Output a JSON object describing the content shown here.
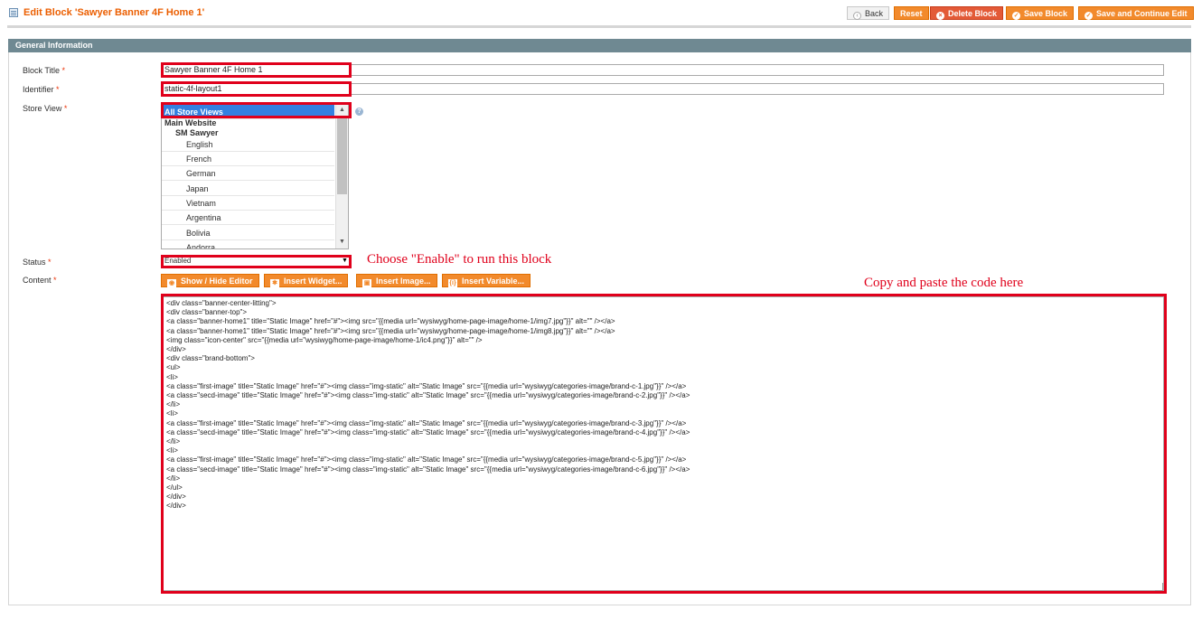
{
  "header": {
    "title": "Edit Block 'Sawyer Banner 4F Home 1'",
    "buttons": {
      "back": "Back",
      "reset": "Reset",
      "delete": "Delete Block",
      "save": "Save Block",
      "save_continue": "Save and Continue Edit"
    }
  },
  "section": {
    "title": "General Information"
  },
  "fields": {
    "block_title": {
      "label": "Block Title",
      "value": "Sawyer Banner 4F Home 1"
    },
    "identifier": {
      "label": "Identifier",
      "value": "static-4f-layout1"
    },
    "store_view": {
      "label": "Store View",
      "selected": "All Store Views",
      "group": "Main Website",
      "subgroup": "SM Sawyer",
      "options": [
        "English",
        "French",
        "German",
        "Japan",
        "Vietnam",
        "Argentina",
        "Bolivia",
        "Andorra"
      ]
    },
    "status": {
      "label": "Status",
      "value": "Enabled"
    },
    "content": {
      "label": "Content"
    },
    "required_mark": "*"
  },
  "wysiwyg_buttons": {
    "show_hide": "Show / Hide Editor",
    "widget": "Insert Widget...",
    "image": "Insert Image...",
    "variable": "Insert Variable..."
  },
  "annotations": {
    "status_note": "Choose \"Enable\" to run this block",
    "content_note": "Copy and paste the code here"
  },
  "content_lines": [
    "<div class=\"banner-center-litting\">",
    "<div class=\"banner-top\">",
    "<a class=\"banner-home1\" title=\"Static Image\" href=\"#\"><img src=\"{{media url=\"wysiwyg/home-page-image/home-1/img7.jpg\"}}\" alt=\"\" /></a>",
    "<a class=\"banner-home1\" title=\"Static Image\" href=\"#\"><img src=\"{{media url=\"wysiwyg/home-page-image/home-1/img8.jpg\"}}\" alt=\"\" /></a>",
    "<img class=\"icon-center\" src=\"{{media url=\"wysiwyg/home-page-image/home-1/ic4.png\"}}\" alt=\"\" />",
    "</div>",
    "<div class=\"brand-bottom\">",
    "<ul>",
    "<li>",
    "<a class=\"first-image\" title=\"Static Image\" href=\"#\"><img class=\"img-static\" alt=\"Static Image\" src=\"{{media url=\"wysiwyg/categories-image/brand-c-1.jpg\"}}\" /></a>",
    "<a class=\"secd-image\" title=\"Static Image\" href=\"#\"><img class=\"img-static\" alt=\"Static Image\" src=\"{{media url=\"wysiwyg/categories-image/brand-c-2.jpg\"}}\" /></a>",
    "</li>",
    "<li>",
    "<a class=\"first-image\" title=\"Static Image\" href=\"#\"><img class=\"img-static\" alt=\"Static Image\" src=\"{{media url=\"wysiwyg/categories-image/brand-c-3.jpg\"}}\" /></a>",
    "<a class=\"secd-image\" title=\"Static Image\" href=\"#\"><img class=\"img-static\" alt=\"Static Image\" src=\"{{media url=\"wysiwyg/categories-image/brand-c-4.jpg\"}}\" /></a>",
    "</li>",
    "<li>",
    "<a class=\"first-image\" title=\"Static Image\" href=\"#\"><img class=\"img-static\" alt=\"Static Image\" src=\"{{media url=\"wysiwyg/categories-image/brand-c-5.jpg\"}}\" /></a>",
    "<a class=\"secd-image\" title=\"Static Image\" href=\"#\"><img class=\"img-static\" alt=\"Static Image\" src=\"{{media url=\"wysiwyg/categories-image/brand-c-6.jpg\"}}\" /></a>",
    "</li>",
    "</ul>",
    "</div>",
    "</div>"
  ],
  "colors": {
    "accent": "#eb5e00",
    "button": "#f28a2c",
    "highlight": "#e0001b",
    "legend": "#6f8992"
  }
}
